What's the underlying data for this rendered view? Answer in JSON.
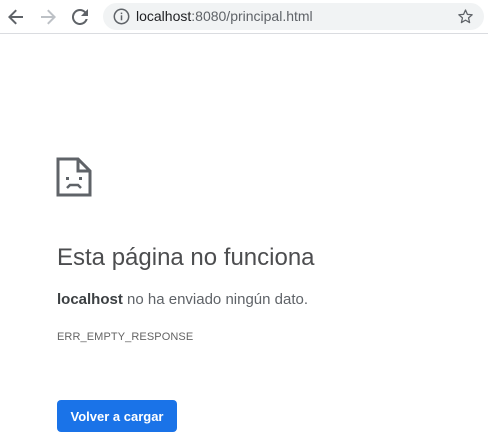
{
  "browser": {
    "url_host": "localhost",
    "url_rest": ":8080/principal.html",
    "icons": [
      "back-arrow-icon",
      "forward-arrow-icon",
      "reload-icon",
      "info-icon",
      "star-icon"
    ]
  },
  "error": {
    "icon": "sad-page-icon",
    "title": "Esta página no funciona",
    "host": "localhost",
    "message": " no ha enviado ningún dato.",
    "code": "ERR_EMPTY_RESPONSE",
    "reload_label": "Volver a cargar"
  },
  "colors": {
    "accent": "#1a73e8",
    "omnibox_bg": "#f1f3f4"
  }
}
